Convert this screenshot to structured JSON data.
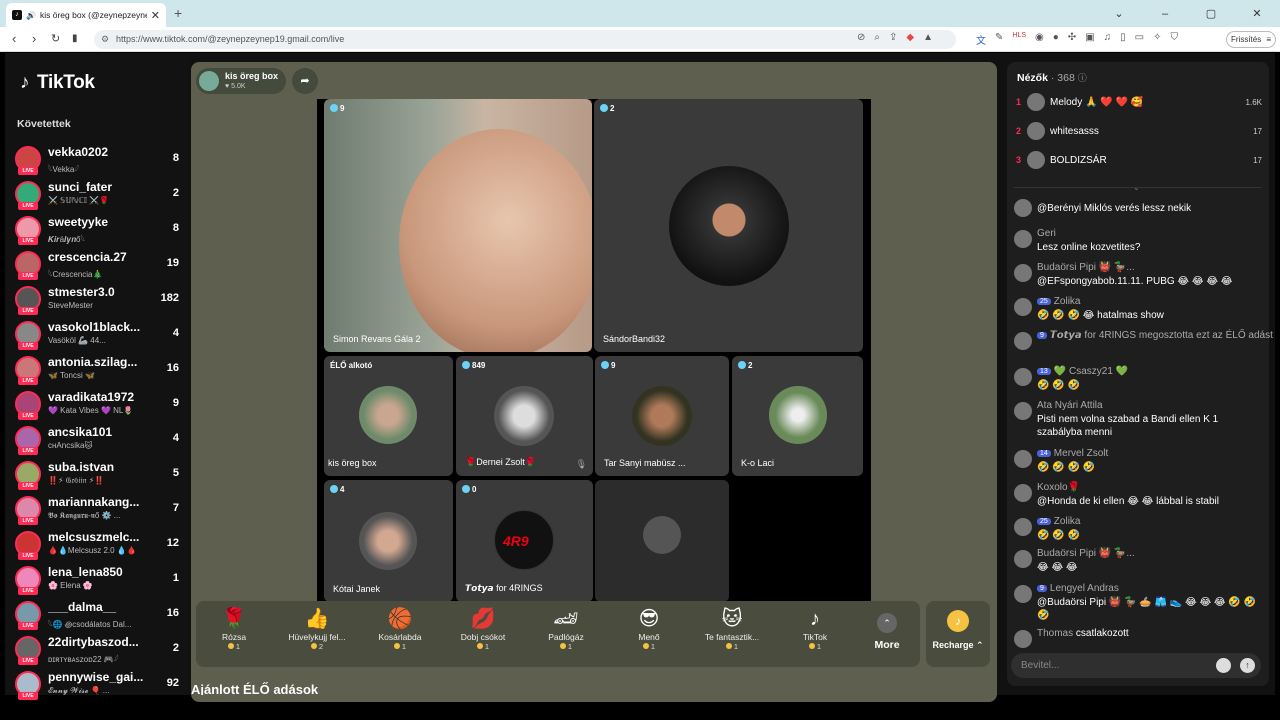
{
  "browser": {
    "tab_title": "kis öreg box (@zeynepzeyne",
    "url": "https://www.tiktok.com/@zeynepzeynep19.gmail.com/live",
    "update_label": "Frissítés"
  },
  "sidebar": {
    "logo": "TikTok",
    "following_label": "Követettek",
    "users": [
      {
        "name": "vekka0202",
        "sub": "𓆩Vekka𓆪",
        "count": "8"
      },
      {
        "name": "sunci_fater",
        "sub": "⚔️ 𝕊𝕌ℕℂ𝕀 ⚔️🌹",
        "count": "2"
      },
      {
        "name": "sweetyyke",
        "sub": "𝑲𝒊𝒓á𝒍𝒚𝒏ő𓆩",
        "count": "8"
      },
      {
        "name": "crescencia.27",
        "sub": "𓆩Crescencia🎄",
        "count": "19"
      },
      {
        "name": "stmester3.0",
        "sub": "SteveMester",
        "count": "182"
      },
      {
        "name": "vasokol1black...",
        "sub": "Vasököl 🦾 44...",
        "count": "4"
      },
      {
        "name": "antonia.szilag...",
        "sub": "🦋 Toncsi 🦋",
        "count": "16"
      },
      {
        "name": "varadikata1972",
        "sub": "💜 Kata Vibes 💜 NL🌷",
        "count": "9"
      },
      {
        "name": "ancsika101",
        "sub": "ᴄʜAncsika🐱",
        "count": "4"
      },
      {
        "name": "suba.istvan",
        "sub": "‼️⚡ 𝔊𝔬𝔟𝔦𝔦𝔫 ⚡‼️",
        "count": "5"
      },
      {
        "name": "mariannakang...",
        "sub": "𝕭𝖔 𝕶𝖆𝖓𝖌𝖚𝖗𝖚-𝖓ő ⚙️ ...",
        "count": "7"
      },
      {
        "name": "melcsuszmelc...",
        "sub": "🩸💧Melcsusz 2.0 💧🩸",
        "count": "12"
      },
      {
        "name": "lena_lena850",
        "sub": "🌸 Elena 🌸",
        "count": "1"
      },
      {
        "name": "___dalma__",
        "sub": "𓆩🌐 ꩜csodálatos Dal...",
        "count": "16"
      },
      {
        "name": "22dirtybaszod...",
        "sub": "ᴅɪʀᴛʏʙᴀꜱᴢᴏᴅ22 🎮𓆪",
        "count": "2"
      },
      {
        "name": "pennywise_gai...",
        "sub": "𝓔𝓷𝓷𝔂 𝓦𝓲𝓼𝓮 🎈 ...",
        "count": "92"
      }
    ]
  },
  "stage": {
    "host_name": "kis öreg box",
    "host_likes": "♥ 5.0K",
    "tiles": [
      {
        "name": "Simon Revans Gála 2",
        "count": "9"
      },
      {
        "name": "SándorBandi32",
        "count": "2"
      },
      {
        "name": "kis öreg box",
        "count": "ÉLŐ alkotó"
      },
      {
        "name": "🌹Dernei Zsolt🌹",
        "count": "849"
      },
      {
        "name": "Tar Sanyi mabüsz ...",
        "count": "9"
      },
      {
        "name": "K-o Laci",
        "count": "2"
      },
      {
        "name": "Kótai Janek",
        "count": "4"
      },
      {
        "name": "𝙏𝙤𝙩𝙮𝙖 for 4RINGS",
        "count": "0"
      },
      {
        "name": "",
        "count": ""
      }
    ],
    "gifts": [
      {
        "name": "Rózsa",
        "price": "1",
        "icon": "🌹"
      },
      {
        "name": "Hüvelykujj fel...",
        "price": "2",
        "icon": "👍"
      },
      {
        "name": "Kosárlabda",
        "price": "1",
        "icon": "🏀"
      },
      {
        "name": "Dobj csókot",
        "price": "1",
        "icon": "💋"
      },
      {
        "name": "Padlógáz",
        "price": "1",
        "icon": "🏎"
      },
      {
        "name": "Menő",
        "price": "1",
        "icon": "😎"
      },
      {
        "name": "Te fantasztik...",
        "price": "1",
        "icon": "🐱"
      },
      {
        "name": "TikTok",
        "price": "1",
        "icon": "♪"
      }
    ],
    "more_label": "More",
    "recharge_label": "Recharge ⌃",
    "recommended_label": "Ajánlott ÉLŐ adások"
  },
  "chat": {
    "viewers_label": "Nézők",
    "viewers_count": "· 368",
    "top": [
      {
        "rank": "1",
        "name": "Melody 🙏 ❤️ ❤️ 🥰",
        "value": "1.6K"
      },
      {
        "rank": "2",
        "name": "whitesasss",
        "value": "17"
      },
      {
        "rank": "3",
        "name": "BOLDIZSÁR",
        "value": "17"
      }
    ],
    "messages": [
      {
        "user": "",
        "badge": "",
        "text": "@Berényi Miklós verés lessz nekik"
      },
      {
        "user": "Geri",
        "badge": "",
        "text": "Lesz online kozvetites?"
      },
      {
        "user": "Budaörsi Pipi 👹 🦆...",
        "badge": "",
        "text": "@EFspongyabob.11.11. PUBG 😂 😂 😂 😂"
      },
      {
        "user": "Zolika",
        "badge": "25",
        "text": "🤣 🤣 🤣 😂 hatalmas show"
      },
      {
        "user": "𝙏𝙤𝙩𝙮𝙖 for 4RINGS megosztotta ezt az ÉLŐ adást",
        "badge": "9",
        "text": ""
      },
      {
        "user": "💚 Csaszy21 💚",
        "badge": "13",
        "text": "🤣 🤣 🤣"
      },
      {
        "user": "Ata Nyári Attila",
        "badge": "",
        "text": "Pisti nem volna szabad a Bandi ellen K 1 szabályba menni"
      },
      {
        "user": "Mervel Zsolt",
        "badge": "14",
        "text": "🤣 🤣 🤣 🤣"
      },
      {
        "user": "Koxolo🌹",
        "badge": "",
        "text": "@Honda de ki ellen 😂 😂 lábbal is stabil"
      },
      {
        "user": "Zolika",
        "badge": "25",
        "text": "🤣 🤣 🤣"
      },
      {
        "user": "Budaörsi Pipi 👹 🦆...",
        "badge": "",
        "text": "😂 😂 😂"
      },
      {
        "user": "Lengyel Andras",
        "badge": "9",
        "text": "@Budaörsi Pipi 👹 🦆 🥧 🩳 👟 😂 😂 😂 🤣 🤣 🤣"
      },
      {
        "user": "Thomas",
        "badge": "",
        "text": "csatlakozott"
      }
    ],
    "input_placeholder": "Bevitel..."
  }
}
